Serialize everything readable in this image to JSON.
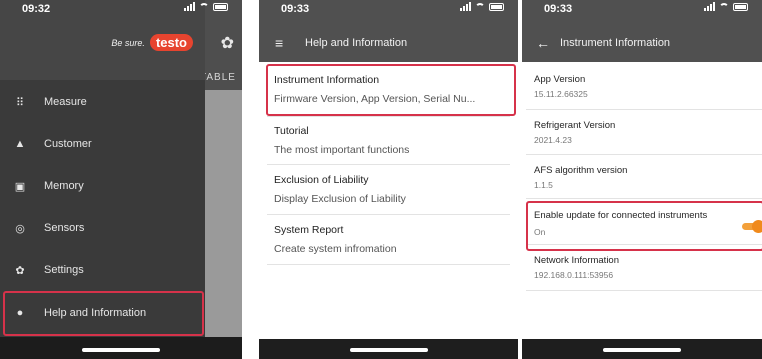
{
  "phone1": {
    "status": {
      "time": "09:32"
    },
    "slogan": "Be sure.",
    "brand": "testo",
    "background_tab": "TABLE",
    "menu": [
      {
        "icon": "grid-icon",
        "label": "Measure"
      },
      {
        "icon": "person-icon",
        "label": "Customer"
      },
      {
        "icon": "memory-icon",
        "label": "Memory"
      },
      {
        "icon": "sensor-icon",
        "label": "Sensors"
      },
      {
        "icon": "gear-icon",
        "label": "Settings"
      },
      {
        "icon": "help-icon",
        "label": "Help and Information"
      }
    ],
    "highlight_color": "#d6324a"
  },
  "phone2": {
    "status": {
      "time": "09:33"
    },
    "title": "Help and Information",
    "items": [
      {
        "title": "Instrument Information",
        "subtitle": "Firmware Version, App Version, Serial Nu..."
      },
      {
        "title": "Tutorial",
        "subtitle": "The most important functions"
      },
      {
        "title": "Exclusion of Liability",
        "subtitle": "Display Exclusion of Liability"
      },
      {
        "title": "System Report",
        "subtitle": "Create system infromation"
      }
    ]
  },
  "phone3": {
    "status": {
      "time": "09:33"
    },
    "title": "Instrument Information",
    "items": [
      {
        "title": "App Version",
        "value": "15.11.2.66325"
      },
      {
        "title": "Refrigerant Version",
        "value": "2021.4.23"
      },
      {
        "title": "AFS algorithm version",
        "value": "1.1.5"
      },
      {
        "title": "Enable update for connected instruments",
        "value": "On"
      },
      {
        "title": "Network Information",
        "value": "192.168.0.111:53956"
      }
    ],
    "toggle_on": true,
    "accent": "#f08a1c"
  }
}
